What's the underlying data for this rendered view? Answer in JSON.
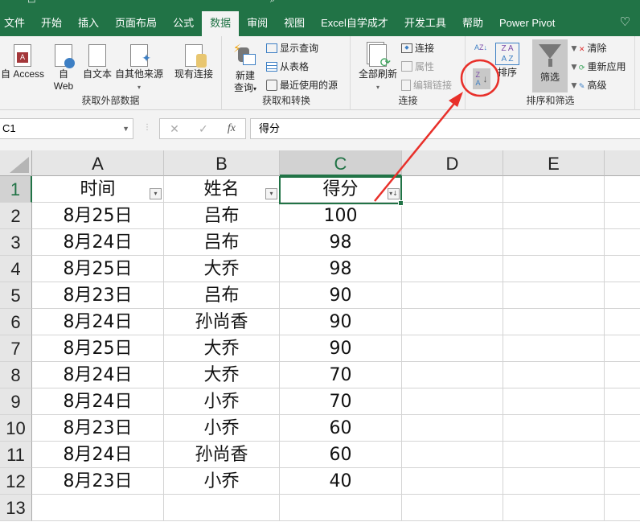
{
  "ribbon_tabs": [
    {
      "label": "文件",
      "active": false
    },
    {
      "label": "开始",
      "active": false
    },
    {
      "label": "插入",
      "active": false
    },
    {
      "label": "页面布局",
      "active": false
    },
    {
      "label": "公式",
      "active": false
    },
    {
      "label": "数据",
      "active": true
    },
    {
      "label": "审阅",
      "active": false
    },
    {
      "label": "视图",
      "active": false
    },
    {
      "label": "Excel自学成才",
      "active": false
    },
    {
      "label": "开发工具",
      "active": false
    },
    {
      "label": "帮助",
      "active": false
    },
    {
      "label": "Power Pivot",
      "active": false
    }
  ],
  "groups": {
    "external": {
      "label": "获取外部数据",
      "access": "自 Access",
      "web1": "自",
      "web2": "Web",
      "text": "自文本",
      "other": "自其他来源",
      "existing": "现有连接"
    },
    "transform": {
      "label": "获取和转换",
      "newq1": "新建",
      "newq2": "查询",
      "show": "显示查询",
      "table": "从表格",
      "recent": "最近使用的源"
    },
    "connections": {
      "label": "连接",
      "refresh": "全部刷新",
      "conn": "连接",
      "props": "属性",
      "edit": "编辑链接"
    },
    "sortfilter": {
      "label": "排序和筛选",
      "sort": "排序",
      "filter": "筛选",
      "clear": "清除",
      "reapply": "重新应用",
      "advanced": "高级"
    }
  },
  "formula_bar": {
    "name_box": "C1",
    "formula": "得分",
    "fx": "fx",
    "cancel": "✕",
    "enter": "✓"
  },
  "columns": [
    "A",
    "B",
    "C",
    "D",
    "E"
  ],
  "rows": [
    {
      "n": "1",
      "a": "时间",
      "b": "姓名",
      "c": "得分"
    },
    {
      "n": "2",
      "a": "8月25日",
      "b": "吕布",
      "c": "100"
    },
    {
      "n": "3",
      "a": "8月24日",
      "b": "吕布",
      "c": "98"
    },
    {
      "n": "4",
      "a": "8月25日",
      "b": "大乔",
      "c": "98"
    },
    {
      "n": "5",
      "a": "8月23日",
      "b": "吕布",
      "c": "90"
    },
    {
      "n": "6",
      "a": "8月24日",
      "b": "孙尚香",
      "c": "90"
    },
    {
      "n": "7",
      "a": "8月25日",
      "b": "大乔",
      "c": "90"
    },
    {
      "n": "8",
      "a": "8月24日",
      "b": "大乔",
      "c": "70"
    },
    {
      "n": "9",
      "a": "8月24日",
      "b": "小乔",
      "c": "70"
    },
    {
      "n": "10",
      "a": "8月23日",
      "b": "小乔",
      "c": "60"
    },
    {
      "n": "11",
      "a": "8月24日",
      "b": "孙尚香",
      "c": "60"
    },
    {
      "n": "12",
      "a": "8月23日",
      "b": "小乔",
      "c": "40"
    },
    {
      "n": "13",
      "a": "",
      "b": "",
      "c": ""
    }
  ],
  "colors": {
    "excel_green": "#217346",
    "annotation_red": "#e8302a"
  }
}
